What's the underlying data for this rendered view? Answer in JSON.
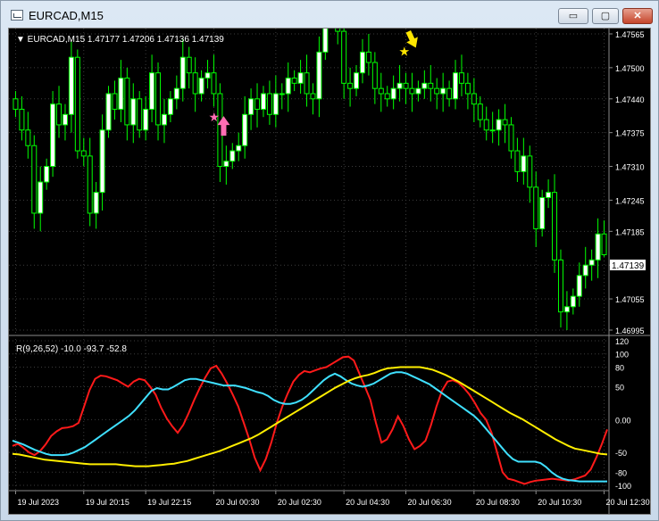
{
  "window": {
    "title": "EURCAD,M15"
  },
  "buttons": {
    "minimize": "▭",
    "maximize": "▢",
    "close": "✕"
  },
  "main_chart": {
    "header": "▼ EURCAD,M15  1.47177 1.47206 1.47136 1.47139",
    "price_tag": "1.47139"
  },
  "oscillator": {
    "header": "R(9,26,52) -10.0 -93.7 -52.8"
  },
  "colors": {
    "background": "#000000",
    "grid": "#3c3c3c",
    "bull_candle": "#ffffff",
    "bear_candle": "#00ff00",
    "buy_arrow": "#ff6eb4",
    "sell_arrow": "#ffe600",
    "fast_line": "#ff1a1a",
    "mid_line": "#3fe0ff",
    "slow_line": "#ffee00",
    "axis_text": "#ffffff"
  },
  "chart_data": [
    {
      "type": "candlestick",
      "symbol": "EURCAD",
      "timeframe": "M15",
      "ohlc_last": {
        "open": 1.47177,
        "high": 1.47206,
        "low": 1.47136,
        "close": 1.47139
      },
      "yticks": [
        "1.47565",
        "1.47500",
        "1.47440",
        "1.47375",
        "1.47310",
        "1.47245",
        "1.47185",
        "1.47120",
        "1.47055",
        "1.46995"
      ],
      "ylim": [
        1.46995,
        1.47565
      ],
      "xticks": [
        "19 Jul 2023",
        "19 Jul 20:15",
        "19 Jul 22:15",
        "20 Jul 00:30",
        "20 Jul 02:30",
        "20 Jul 04:30",
        "20 Jul 06:30",
        "20 Jul 08:30",
        "20 Jul 10:30",
        "20 Jul 12:30"
      ],
      "signals": [
        {
          "type": "buy",
          "near_time": "20 Jul 00:30",
          "price": 1.474
        },
        {
          "type": "sell",
          "near_time": "20 Jul 06:30",
          "price": 1.4753
        }
      ],
      "closes": [
        1.4742,
        1.4738,
        1.4735,
        1.4722,
        1.4728,
        1.4731,
        1.4743,
        1.4739,
        1.4741,
        1.4752,
        1.4734,
        1.4733,
        1.4722,
        1.4726,
        1.4738,
        1.4745,
        1.4742,
        1.4748,
        1.4739,
        1.4744,
        1.4738,
        1.4742,
        1.4749,
        1.4739,
        1.4741,
        1.4744,
        1.4746,
        1.4752,
        1.4749,
        1.4745,
        1.4748,
        1.4749,
        1.4745,
        1.4731,
        1.4732,
        1.4734,
        1.4735,
        1.4741,
        1.4744,
        1.4742,
        1.4745,
        1.4741,
        1.4745,
        1.4745,
        1.4748,
        1.4747,
        1.4749,
        1.4745,
        1.4744,
        1.4753,
        1.4762,
        1.4766,
        1.4757,
        1.4747,
        1.4746,
        1.4749,
        1.4753,
        1.4751,
        1.4746,
        1.4745,
        1.4744,
        1.4746,
        1.4747,
        1.4746,
        1.4745,
        1.4746,
        1.4747,
        1.4746,
        1.4745,
        1.4746,
        1.4744,
        1.4749,
        1.4747,
        1.4745,
        1.4743,
        1.474,
        1.4738,
        1.4738,
        1.474,
        1.4739,
        1.4734,
        1.473,
        1.4733,
        1.4727,
        1.4719,
        1.4725,
        1.4726,
        1.4713,
        1.4703,
        1.4704,
        1.4706,
        1.471,
        1.4712,
        1.4713,
        1.4718,
        1.4714
      ]
    },
    {
      "type": "line",
      "indicator": "R(9,26,52)",
      "current_values": [
        -10.0,
        -93.7,
        -52.8
      ],
      "yticks": [
        "120",
        "100",
        "80",
        "50",
        "0.00",
        "-50",
        "-80",
        "-100"
      ],
      "ylim": [
        -100,
        120
      ],
      "series": [
        {
          "values": [
            -40,
            -37,
            -43,
            -50,
            -54,
            -48,
            -38,
            -25,
            -18,
            -13,
            -12,
            -10,
            -5,
            20,
            45,
            62,
            67,
            66,
            63,
            60,
            55,
            50,
            58,
            62,
            60,
            50,
            38,
            18,
            2,
            -10,
            -20,
            -8,
            10,
            30,
            48,
            64,
            78,
            82,
            70,
            55,
            38,
            20,
            -5,
            -30,
            -58,
            -77,
            -60,
            -35,
            -5,
            20,
            40,
            58,
            68,
            74,
            72,
            75,
            78,
            80,
            85,
            90,
            95,
            96,
            90,
            70,
            50,
            30,
            -5,
            -35,
            -30,
            -15,
            5,
            -10,
            -30,
            -45,
            -40,
            -32,
            -8,
            20,
            44,
            58,
            60,
            56,
            48,
            38,
            25,
            10,
            0,
            -20,
            -50,
            -80,
            -90,
            -92,
            -95,
            -98,
            -95,
            -93,
            -92,
            -91,
            -90,
            -91,
            -92,
            -93,
            -91,
            -88,
            -85,
            -76,
            -58,
            -38,
            -15
          ]
        },
        {
          "values": [
            -32,
            -35,
            -38,
            -42,
            -46,
            -49,
            -52,
            -54,
            -54,
            -54,
            -53,
            -50,
            -46,
            -42,
            -36,
            -30,
            -24,
            -18,
            -12,
            -6,
            0,
            6,
            14,
            24,
            34,
            44,
            48,
            46,
            46,
            50,
            55,
            60,
            62,
            62,
            60,
            58,
            56,
            54,
            52,
            52,
            52,
            50,
            48,
            45,
            42,
            40,
            36,
            30,
            26,
            24,
            24,
            26,
            30,
            36,
            44,
            52,
            60,
            66,
            70,
            66,
            60,
            55,
            52,
            50,
            52,
            55,
            60,
            65,
            70,
            72,
            72,
            70,
            66,
            62,
            58,
            54,
            48,
            42,
            36,
            30,
            24,
            18,
            12,
            6,
            -2,
            -12,
            -22,
            -32,
            -42,
            -52,
            -60,
            -64,
            -64,
            -64,
            -64,
            -66,
            -72,
            -80,
            -86,
            -90,
            -92,
            -93,
            -94,
            -94,
            -94,
            -94,
            -94,
            -94
          ]
        },
        {
          "values": [
            -52,
            -53,
            -55,
            -57,
            -59,
            -61,
            -62,
            -63,
            -64,
            -65,
            -66,
            -67,
            -68,
            -68,
            -68,
            -68,
            -68,
            -69,
            -70,
            -71,
            -71,
            -71,
            -70,
            -69,
            -68,
            -67,
            -65,
            -63,
            -60,
            -57,
            -54,
            -51,
            -48,
            -44,
            -40,
            -36,
            -32,
            -28,
            -23,
            -17,
            -11,
            -5,
            1,
            7,
            13,
            19,
            25,
            31,
            37,
            43,
            49,
            54,
            59,
            63,
            66,
            68,
            71,
            75,
            78,
            79,
            80,
            80,
            80,
            80,
            78,
            76,
            72,
            68,
            63,
            58,
            52,
            46,
            40,
            34,
            28,
            22,
            16,
            10,
            5,
            0,
            -6,
            -12,
            -18,
            -24,
            -30,
            -35,
            -40,
            -44,
            -46,
            -48,
            -50,
            -52,
            -53
          ]
        }
      ]
    }
  ]
}
